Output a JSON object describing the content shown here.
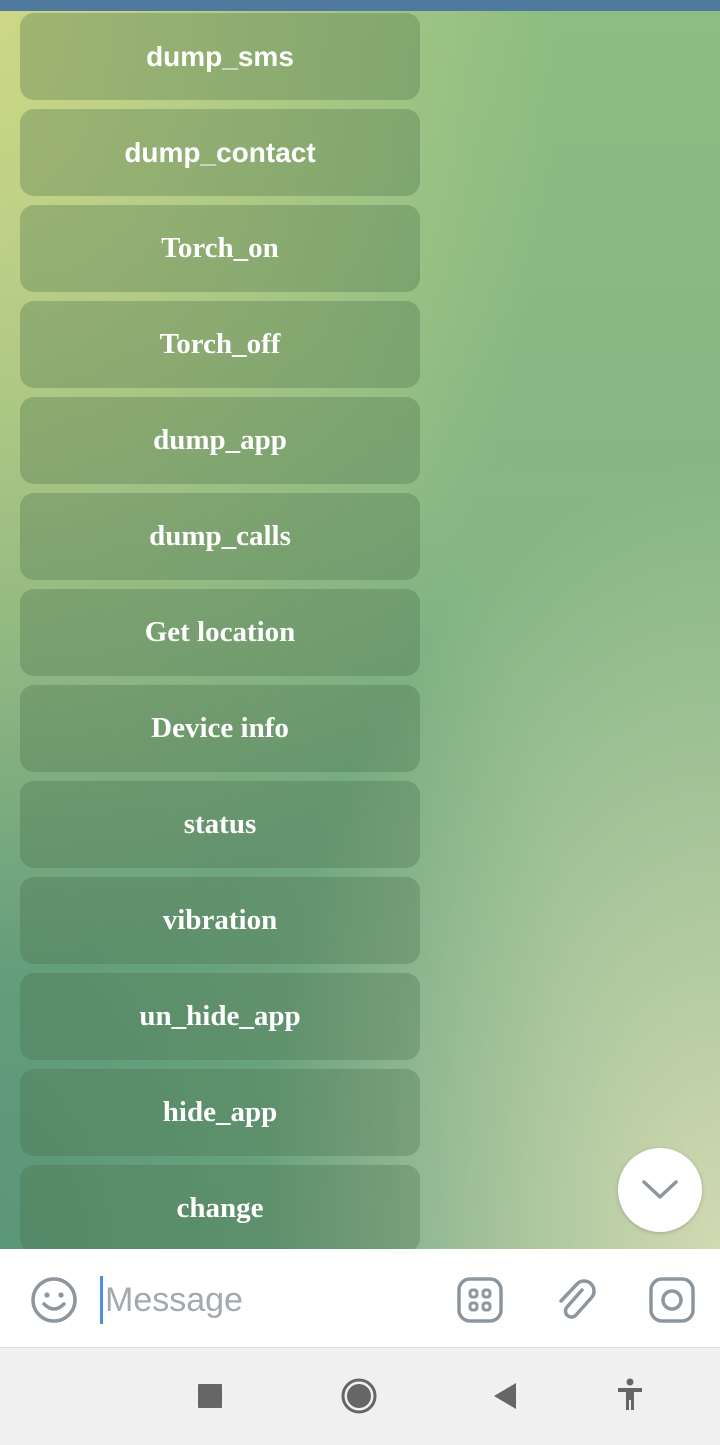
{
  "keyboard": {
    "buttons": [
      {
        "label": "dump_sms"
      },
      {
        "label": "dump_contact"
      },
      {
        "label": "Torch_on"
      },
      {
        "label": "Torch_off"
      },
      {
        "label": "dump_app"
      },
      {
        "label": "dump_calls"
      },
      {
        "label": "Get location"
      },
      {
        "label": "Device info"
      },
      {
        "label": "status"
      },
      {
        "label": "vibration"
      },
      {
        "label": "un_hide_app"
      },
      {
        "label": "hide_app"
      },
      {
        "label": "change"
      }
    ]
  },
  "input": {
    "placeholder": "Message"
  },
  "icons": {
    "emoji": "emoji-icon",
    "stickers": "sticker-grid-icon",
    "attach": "paperclip-icon",
    "camera": "camera-icon",
    "scroll": "chevron-down-icon",
    "recents": "square-icon",
    "home": "circle-icon",
    "back": "triangle-back-icon",
    "accessibility": "accessibility-icon"
  },
  "colors": {
    "topbar": "#5079a0",
    "caret": "#4a90d9",
    "icon": "#8e969d"
  }
}
